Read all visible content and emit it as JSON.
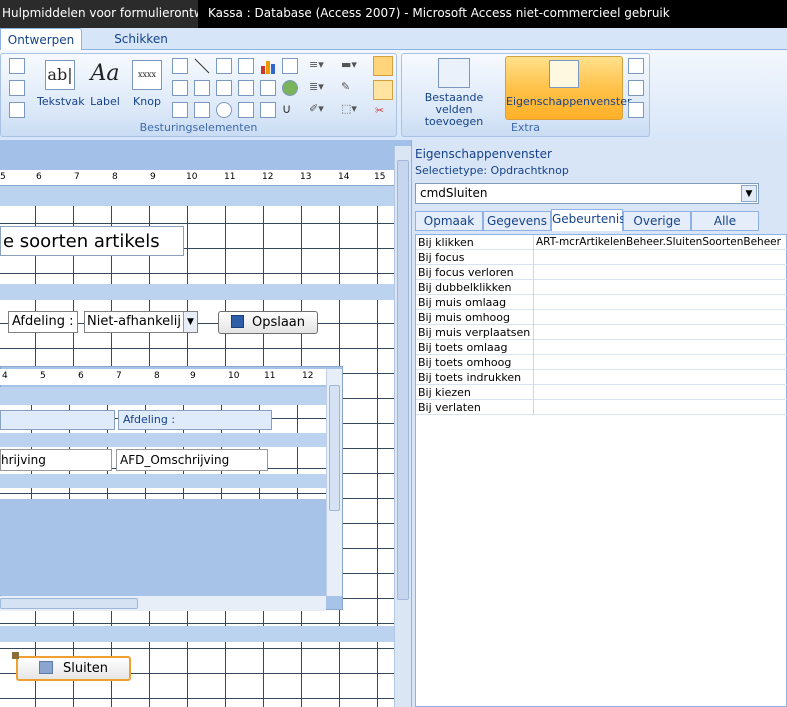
{
  "titlebar": {
    "context_tab": "Hulpmiddelen voor formulierontwerpen",
    "title": "Kassa : Database (Access 2007)  -  Microsoft Access niet-commercieel gebruik"
  },
  "tabs": [
    {
      "label": "Ontwerpen"
    },
    {
      "label": "Schikken"
    }
  ],
  "ribbon": {
    "besturing": {
      "label": "Besturingselementen",
      "buttons": [
        {
          "label": "Tekstvak",
          "icon_text": "ab|"
        },
        {
          "label": "Label",
          "icon_text": "Aa"
        },
        {
          "label": "Knop",
          "icon_text": "xxxx"
        }
      ]
    },
    "extra": {
      "label": "Extra",
      "bestaande": "Bestaande velden toevoegen",
      "eigenschappen": "Eigenschappenvenster"
    }
  },
  "design": {
    "close_glyph": "×",
    "ruler_top": [
      "5",
      "6",
      "7",
      "8",
      "9",
      "10",
      "11",
      "12",
      "13",
      "14",
      "15"
    ],
    "ruler_sub": [
      "4",
      "5",
      "6",
      "7",
      "8",
      "9",
      "10",
      "11",
      "12"
    ],
    "form_title": "e soorten artikels",
    "afdeling_label": "Afdeling :",
    "afdeling_combo": "Niet-afhankelij",
    "opslaan": "Opslaan",
    "sub_afdeling": "Afdeling :",
    "sub_omschrijving": "hrijving",
    "sub_afd_omschrijving": "AFD_Omschrijving",
    "sluiten": "Sluiten"
  },
  "props": {
    "title": "Eigenschappenvenster",
    "seltype": "Selectietype:  Opdrachtknop",
    "object": "cmdSluiten",
    "tabs": [
      "Opmaak",
      "Gegevens",
      "Gebeurtenis",
      "Overige",
      "Alle"
    ],
    "active_tab": "Gebeurtenis",
    "rows": [
      {
        "name": "Bij klikken",
        "value": "ART-mcrArtikelenBeheer.SluitenSoortenBeheer"
      },
      {
        "name": "Bij focus",
        "value": ""
      },
      {
        "name": "Bij focus verloren",
        "value": ""
      },
      {
        "name": "Bij dubbelklikken",
        "value": ""
      },
      {
        "name": "Bij muis omlaag",
        "value": ""
      },
      {
        "name": "Bij muis omhoog",
        "value": ""
      },
      {
        "name": "Bij muis verplaatsen",
        "value": ""
      },
      {
        "name": "Bij toets omlaag",
        "value": ""
      },
      {
        "name": "Bij toets omhoog",
        "value": ""
      },
      {
        "name": "Bij toets indrukken",
        "value": ""
      },
      {
        "name": "Bij kiezen",
        "value": ""
      },
      {
        "name": "Bij verlaten",
        "value": ""
      }
    ]
  },
  "colors": {
    "accent": "#15428b",
    "selection": "#f0a030"
  }
}
